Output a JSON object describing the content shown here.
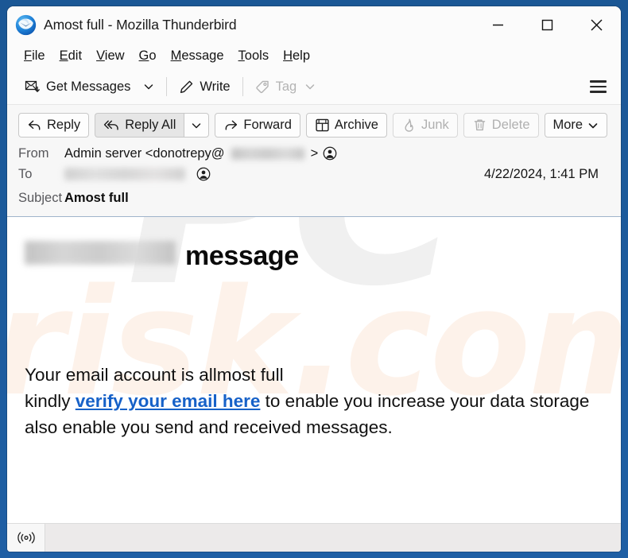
{
  "window": {
    "title": "Amost full - Mozilla Thunderbird",
    "logo_icon": "thunderbird-logo-icon",
    "controls": {
      "minimize": "minimize-icon",
      "maximize": "maximize-icon",
      "close": "close-icon"
    }
  },
  "menubar": {
    "items": [
      {
        "label": "File",
        "accel": "F"
      },
      {
        "label": "Edit",
        "accel": "E"
      },
      {
        "label": "View",
        "accel": "V"
      },
      {
        "label": "Go",
        "accel": "G"
      },
      {
        "label": "Message",
        "accel": "M"
      },
      {
        "label": "Tools",
        "accel": "T"
      },
      {
        "label": "Help",
        "accel": "H"
      }
    ]
  },
  "toolbar": {
    "get_messages_label": "Get Messages",
    "get_messages_icon": "envelope-download-icon",
    "get_messages_caret": "chevron-down-icon",
    "write_label": "Write",
    "write_icon": "pencil-icon",
    "tag_label": "Tag",
    "tag_icon": "tag-icon",
    "tag_caret": "chevron-down-icon",
    "tag_disabled": true,
    "app_menu_icon": "hamburger-menu-icon"
  },
  "actionbar": {
    "buttons": [
      {
        "label": "Reply",
        "icon": "reply-arrow-icon",
        "disabled": false
      },
      {
        "label": "Reply All",
        "icon": "reply-all-arrow-icon",
        "disabled": false
      },
      {
        "label": "Forward",
        "icon": "forward-arrow-icon",
        "disabled": false
      },
      {
        "label": "Archive",
        "icon": "archive-box-icon",
        "disabled": false
      },
      {
        "label": "Junk",
        "icon": "flame-icon",
        "disabled": true
      },
      {
        "label": "Delete",
        "icon": "trash-icon",
        "disabled": true
      },
      {
        "label": "More",
        "icon": "chevron-down-icon",
        "disabled": false
      }
    ],
    "reply_all_caret": "chevron-down-icon"
  },
  "message_header": {
    "from_label": "From",
    "from_value_prefix": "Admin server <donotrepy@",
    "from_value_suffix": ">",
    "from_domain_redacted": true,
    "from_avatar_icon": "contact-avatar-icon",
    "to_label": "To",
    "to_value_redacted": true,
    "to_avatar_icon": "contact-avatar-icon",
    "date": "4/22/2024, 1:41 PM",
    "subject_label": "Subject",
    "subject_value": "Amost full"
  },
  "message_body": {
    "heading_domain_redacted": true,
    "heading_word": "message",
    "line1": "Your email account is allmost full",
    "line2_prefix": "kindly ",
    "link_text": "verify your email here",
    "line2_suffix": " to enable you increase your data storage also enable you send and received messages.",
    "watermark": {
      "part1": "PC",
      "part2": "risk.com"
    }
  },
  "statusbar": {
    "online_icon": "broadcast-online-icon"
  },
  "colors": {
    "desktop_blue": "#1d5a9c",
    "link_blue": "#1661c8",
    "window_bg": "#ffffff",
    "chrome_bg": "#fbfbfb",
    "header_bg": "#f7f7f7",
    "status_bg": "#eceaea"
  }
}
